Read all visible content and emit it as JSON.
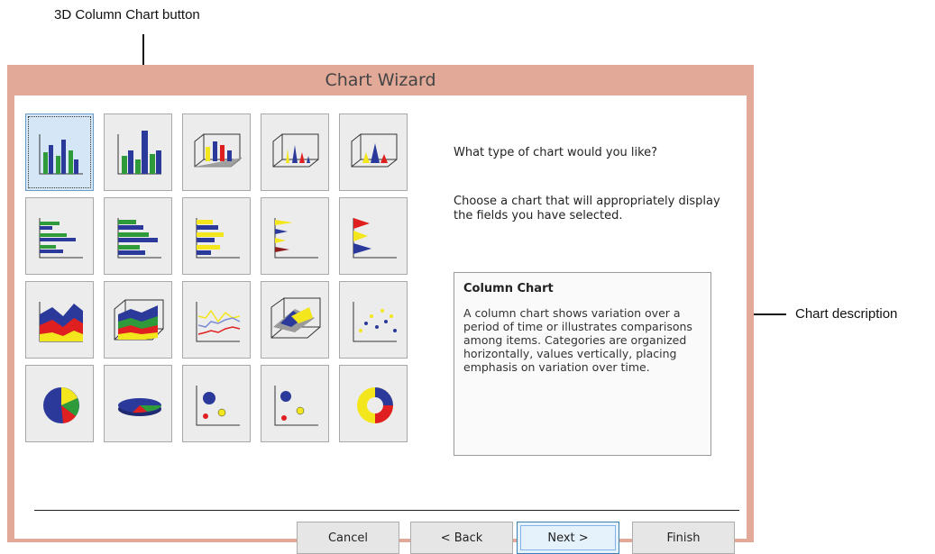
{
  "annotations": {
    "top_label": "3D Column Chart button",
    "right_label": "Chart description"
  },
  "dialog": {
    "title": "Chart Wizard",
    "prompt": "What type of chart would you like?",
    "instruction": "Choose a chart that will appropriately display the fields you have selected.",
    "description": {
      "title": "Column Chart",
      "body": "A column chart shows variation over a period of time or illustrates comparisons among items. Categories are organized horizontally, values vertically, placing emphasis on variation over time."
    },
    "buttons": {
      "cancel": "Cancel",
      "back": "< Back",
      "next": "Next >",
      "finish": "Finish"
    }
  },
  "chart_types": [
    {
      "icon": "column-chart-icon",
      "selected": true
    },
    {
      "icon": "3d-column-chart-icon"
    },
    {
      "icon": "3d-cylinder-chart-icon"
    },
    {
      "icon": "3d-cone-chart-icon"
    },
    {
      "icon": "3d-pyramid-chart-icon"
    },
    {
      "icon": "bar-chart-icon"
    },
    {
      "icon": "3d-bar-chart-icon"
    },
    {
      "icon": "cylinder-bar-chart-icon"
    },
    {
      "icon": "cone-bar-chart-icon"
    },
    {
      "icon": "pyramid-bar-chart-icon"
    },
    {
      "icon": "area-chart-icon"
    },
    {
      "icon": "3d-area-chart-icon"
    },
    {
      "icon": "line-chart-icon"
    },
    {
      "icon": "3d-surface-chart-icon"
    },
    {
      "icon": "scatter-chart-icon"
    },
    {
      "icon": "pie-chart-icon"
    },
    {
      "icon": "3d-pie-chart-icon"
    },
    {
      "icon": "bubble-chart-icon"
    },
    {
      "icon": "3d-bubble-chart-icon"
    },
    {
      "icon": "doughnut-chart-icon"
    }
  ],
  "colors": {
    "title_bar": "#e2a898",
    "blue": "#2b3a9a",
    "green": "#2e9a3a",
    "yellow": "#f3e61d",
    "red": "#e02020"
  }
}
